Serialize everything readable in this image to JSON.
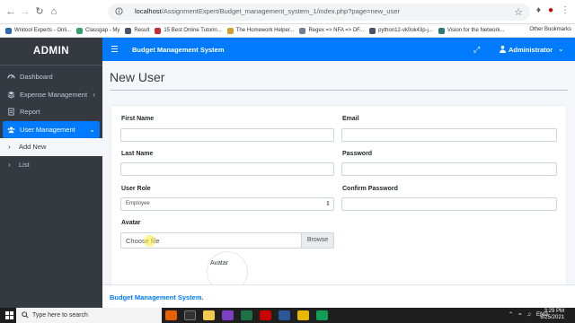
{
  "browser": {
    "url_host": "localhost",
    "url_path": "/AssignmentExpert/Budget_management_system_1/index.php?page=new_user",
    "bookmarks": [
      {
        "label": "Wnitool Experts - Onli...",
        "color": "#2b6cb0"
      },
      {
        "label": "Classgap - My",
        "color": "#38a169"
      },
      {
        "label": "Result",
        "color": "#4a5568"
      },
      {
        "label": "15 Best Online Tutorin...",
        "color": "#c53030"
      },
      {
        "label": "The Homework Helper...",
        "color": "#d69e2e"
      },
      {
        "label": "Regex => NFA => DF...",
        "color": "#718096"
      },
      {
        "label": "python12-vk0ok43p-j...",
        "color": "#4a5568"
      },
      {
        "label": "Vision for the Network...",
        "color": "#2c7a7b"
      }
    ],
    "other_bookmarks": "Other Bookmarks"
  },
  "sidebar": {
    "brand": "ADMIN",
    "items": [
      {
        "label": "Dashboard",
        "icon": "dashboard-icon"
      },
      {
        "label": "Expense Management",
        "icon": "layers-icon",
        "has_caret": true
      },
      {
        "label": "Report",
        "icon": "report-icon"
      },
      {
        "label": "User Management",
        "icon": "users-icon",
        "has_caret": true,
        "active": true
      }
    ],
    "subitems": [
      {
        "label": "Add New"
      },
      {
        "label": "List"
      }
    ]
  },
  "topbar": {
    "title": "Budget Management System",
    "user": "Administrator"
  },
  "page": {
    "title": "New User"
  },
  "form": {
    "first_name_label": "First Name",
    "last_name_label": "Last Name",
    "user_role_label": "User Role",
    "user_role_value": "Employee",
    "avatar_label": "Avatar",
    "file_placeholder": "Choose file",
    "browse_label": "Browse",
    "avatar_preview_label": "Avatar",
    "email_label": "Email",
    "password_label": "Password",
    "confirm_password_label": "Confirm Password"
  },
  "footer": {
    "text": "Budget Management System."
  },
  "taskbar": {
    "search_placeholder": "Type here to search",
    "language": "ENG",
    "time": "3:29 PM",
    "date": "6/25/2021"
  },
  "colors": {
    "primary": "#007bff",
    "sidebar_bg": "#343a40"
  }
}
